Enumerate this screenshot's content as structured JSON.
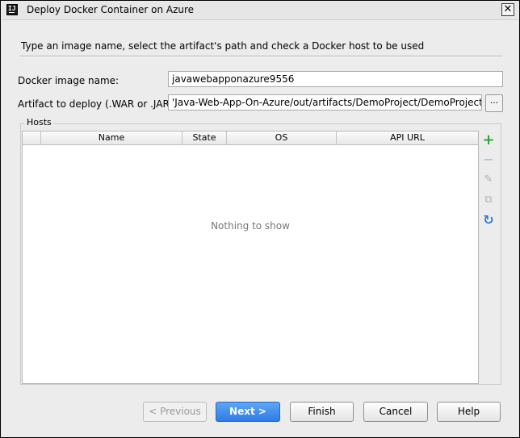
{
  "window": {
    "title": "Deploy Docker Container on Azure",
    "close_glyph": "✕",
    "icon": "intellij-idea-icon"
  },
  "instruction": "Type an image name, select the artifact's path and check a Docker host to be used",
  "form": {
    "image_name_label": "Docker image name:",
    "image_name_value": "javawebapponazure9556",
    "artifact_label": "Artifact to deploy (.WAR or .JAR):",
    "artifact_value": "'Java-Web-App-On-Azure/out/artifacts/DemoProject/DemoProject.war",
    "browse_label": "..."
  },
  "hosts": {
    "group_title": "Hosts",
    "columns": [
      "",
      "Name",
      "State",
      "OS",
      "API URL"
    ],
    "empty_text": "Nothing to show",
    "toolbar": {
      "add": "+",
      "remove": "−",
      "edit": "✎",
      "view": "⧉",
      "refresh": "↻"
    }
  },
  "buttons": {
    "previous": "< Previous",
    "next": "Next >",
    "finish": "Finish",
    "cancel": "Cancel",
    "help": "Help"
  },
  "colors": {
    "accent": "#2f7be6",
    "add_green": "#2fa53a",
    "refresh_blue": "#2a7ad5",
    "disabled_gray": "#b0b0b0"
  }
}
